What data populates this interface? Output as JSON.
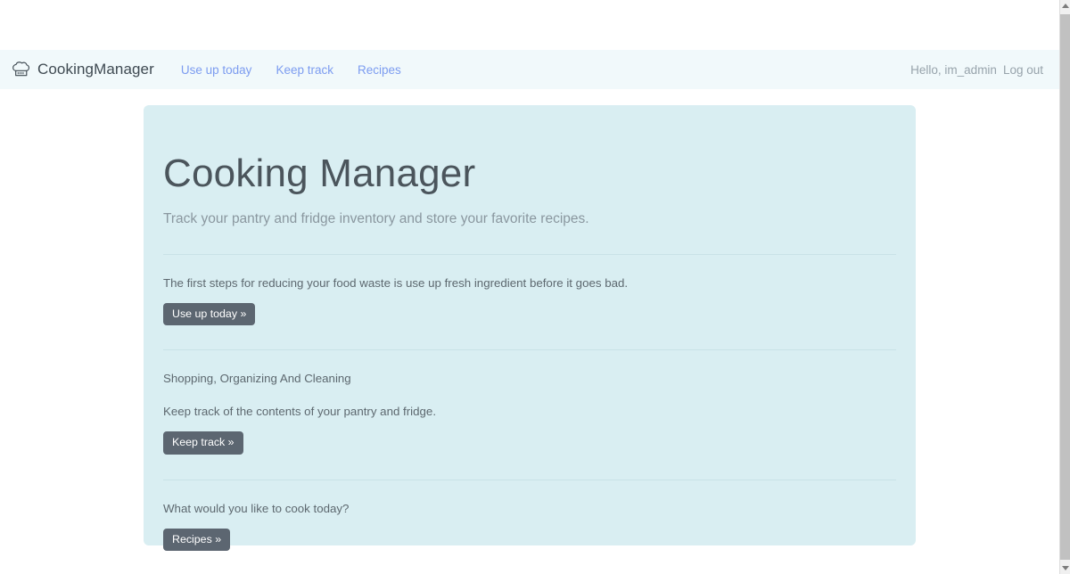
{
  "navbar": {
    "brand_icon": "chef-hat-icon",
    "brand": "CookingManager",
    "links": [
      {
        "label": "Use up today"
      },
      {
        "label": "Keep track"
      },
      {
        "label": "Recipes"
      }
    ],
    "greeting": "Hello, im_admin",
    "logout": "Log out"
  },
  "hero": {
    "title": "Cooking Manager",
    "subtitle": "Track your pantry and fridge inventory and store your favorite recipes.",
    "sections": [
      {
        "text": "The first steps for reducing your food waste is use up fresh ingredient before it goes bad.",
        "button": "Use up today »"
      },
      {
        "title": "Shopping, Organizing And Cleaning",
        "text": "Keep track of the contents of your pantry and fridge.",
        "button": "Keep track »"
      },
      {
        "text": "What would you like to cook today?",
        "button": "Recipes »"
      }
    ]
  },
  "scrollbar": {
    "up_arrow": "scroll-up-arrow-icon",
    "down_arrow": "scroll-down-arrow-icon"
  },
  "colors": {
    "navbar_bg": "#f1f9fb",
    "hero_bg": "#d9eef2",
    "nav_link": "#7c9cf0",
    "button_bg": "#5c6671",
    "divider": "#c9e2e7",
    "page_bg": "#ffffff"
  }
}
